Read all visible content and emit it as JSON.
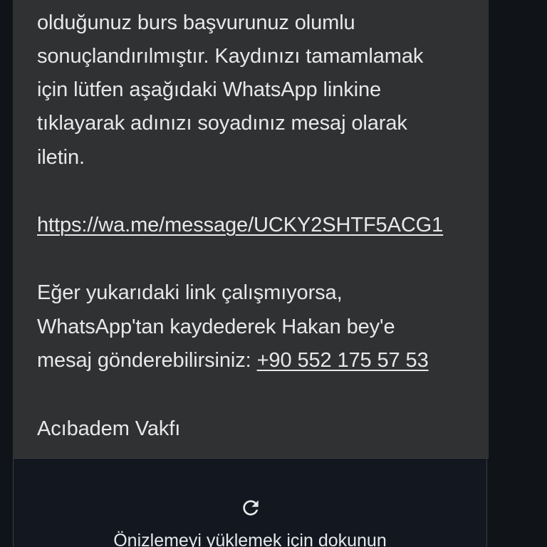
{
  "message": {
    "lines": [
      "olduğunuz burs başvurunuz olumlu",
      "sonuçlandırılmıştır. Kaydınızı tamamlamak",
      "için lütfen aşağıdaki WhatsApp linkine",
      "tıklayarak adınızı soyadınız mesaj olarak",
      "iletin."
    ],
    "link": "https://wa.me/message/UCKY2SHTF5ACG1",
    "fallback_lines": [
      "Eğer yukarıdaki link çalışmıyorsa,",
      "WhatsApp'tan kaydederek Hakan bey'e"
    ],
    "fallback_last_prefix": "mesaj gönderebilirsiniz: ",
    "phone": "+90 552 175 57 53",
    "signature": "Acıbadem Vakfı"
  },
  "preview": {
    "icon": "reload-icon",
    "label": "Önizlemeyi yüklemek için dokunun"
  },
  "colors": {
    "background": "#101419",
    "bubble": "#303133",
    "text": "#e7e8ea"
  }
}
